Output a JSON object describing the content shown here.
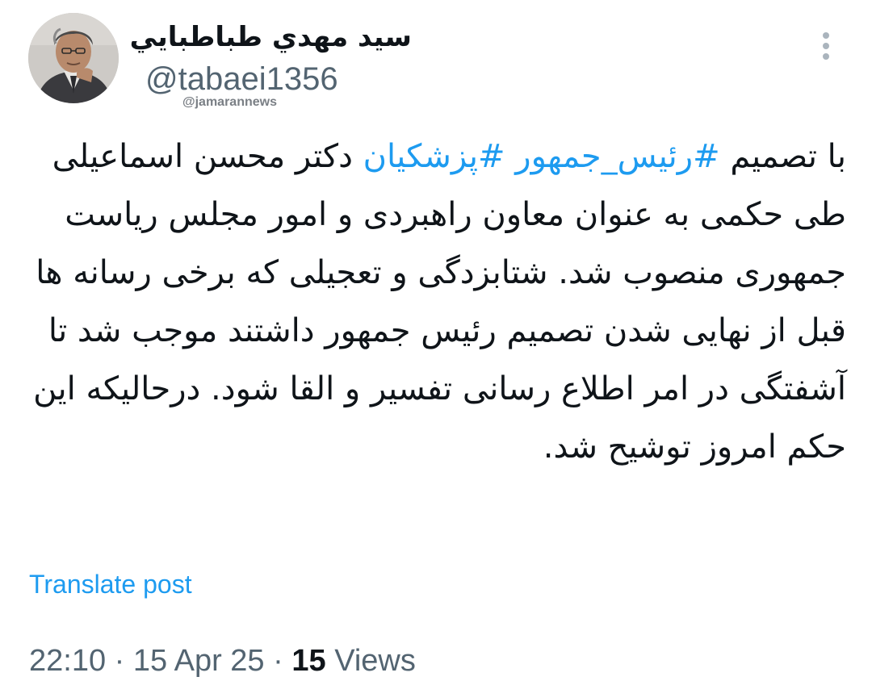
{
  "author": {
    "display_name": "سيد مهدي طباطبايي",
    "handle": "@tabaei1356"
  },
  "watermark": "@jamarannews",
  "more_icon": "more-vertical-icon",
  "tweet": {
    "text_before": "با تصمیم ",
    "hashtag_1": "#رئیس_جمهور",
    "hashtag_2": "#پزشکیان",
    "text_after": " دکتر محسن اسماعیلی طی حکمی به عنوان معاون راهبردی و امور مجلس ریاست جمهوری منصوب شد. شتابزدگی و تعجیلی که برخی رسانه ها قبل از نهایی شدن تصمیم رئیس جمهور داشتند موجب شد تا آشفتگی در امر اطلاع رسانی تفسیر و القا شود. درحالیکه این حکم امروز توشیح شد."
  },
  "translate_label": "Translate post",
  "meta": {
    "time": "22:10",
    "date": "15 Apr 25",
    "views_count": "15",
    "views_label": "Views",
    "separator": "·"
  },
  "colors": {
    "accent": "#1d9bf0",
    "secondary_text": "#536471",
    "primary_text": "#0f1419"
  }
}
